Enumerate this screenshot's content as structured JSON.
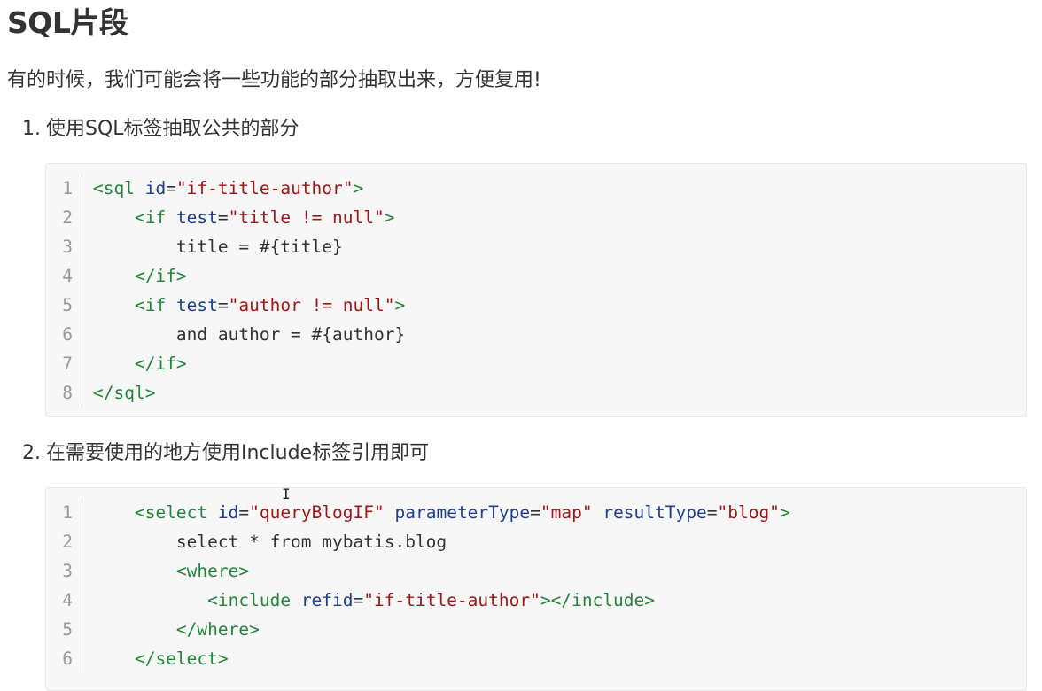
{
  "heading": "SQL片段",
  "intro": "有的时候，我们可能会将一些功能的部分抽取出来，方便复用!",
  "steps": [
    {
      "num": "1.",
      "text": "使用SQL标签抽取公共的部分"
    },
    {
      "num": "2.",
      "text": "在需要使用的地方使用Include标签引用即可"
    }
  ],
  "code_blocks": [
    {
      "line_numbers": [
        "1",
        "2",
        "3",
        "4",
        "5",
        "6",
        "7",
        "8"
      ],
      "lines": [
        [
          {
            "t": "tag",
            "v": "<sql "
          },
          {
            "t": "attr",
            "v": "id"
          },
          {
            "t": "punct",
            "v": "="
          },
          {
            "t": "str",
            "v": "\"if-title-author\""
          },
          {
            "t": "tag",
            "v": ">"
          }
        ],
        [
          {
            "t": "punct",
            "v": "    "
          },
          {
            "t": "tag",
            "v": "<if "
          },
          {
            "t": "attr",
            "v": "test"
          },
          {
            "t": "punct",
            "v": "="
          },
          {
            "t": "str",
            "v": "\"title != null\""
          },
          {
            "t": "tag",
            "v": ">"
          }
        ],
        [
          {
            "t": "punct",
            "v": "        title = #{title}"
          }
        ],
        [
          {
            "t": "punct",
            "v": "    "
          },
          {
            "t": "tag",
            "v": "</if>"
          }
        ],
        [
          {
            "t": "punct",
            "v": "    "
          },
          {
            "t": "tag",
            "v": "<if "
          },
          {
            "t": "attr",
            "v": "test"
          },
          {
            "t": "punct",
            "v": "="
          },
          {
            "t": "str",
            "v": "\"author != null\""
          },
          {
            "t": "tag",
            "v": ">"
          }
        ],
        [
          {
            "t": "punct",
            "v": "        and author = #{author}"
          }
        ],
        [
          {
            "t": "punct",
            "v": "    "
          },
          {
            "t": "tag",
            "v": "</if>"
          }
        ],
        [
          {
            "t": "tag",
            "v": "</sql>"
          }
        ]
      ]
    },
    {
      "line_numbers": [
        "1",
        "2",
        "3",
        "4",
        "5",
        "6"
      ],
      "lines": [
        [
          {
            "t": "punct",
            "v": "    "
          },
          {
            "t": "tag",
            "v": "<select "
          },
          {
            "t": "attr",
            "v": "id"
          },
          {
            "t": "punct",
            "v": "="
          },
          {
            "t": "str",
            "v": "\"queryBlogIF\""
          },
          {
            "t": "punct",
            "v": " "
          },
          {
            "t": "attr",
            "v": "parameterType"
          },
          {
            "t": "punct",
            "v": "="
          },
          {
            "t": "str",
            "v": "\"map\""
          },
          {
            "t": "punct",
            "v": " "
          },
          {
            "t": "attr",
            "v": "resultType"
          },
          {
            "t": "punct",
            "v": "="
          },
          {
            "t": "str",
            "v": "\"blog\""
          },
          {
            "t": "tag",
            "v": ">"
          }
        ],
        [
          {
            "t": "punct",
            "v": "        select * from mybatis.blog"
          }
        ],
        [
          {
            "t": "punct",
            "v": "        "
          },
          {
            "t": "tag",
            "v": "<where>"
          }
        ],
        [
          {
            "t": "punct",
            "v": "           "
          },
          {
            "t": "tag",
            "v": "<include "
          },
          {
            "t": "attr",
            "v": "refid"
          },
          {
            "t": "punct",
            "v": "="
          },
          {
            "t": "str",
            "v": "\"if-title-author\""
          },
          {
            "t": "tag",
            "v": "></include>"
          }
        ],
        [
          {
            "t": "punct",
            "v": "        "
          },
          {
            "t": "tag",
            "v": "</where>"
          }
        ],
        [
          {
            "t": "punct",
            "v": "    "
          },
          {
            "t": "tag",
            "v": "</select>"
          }
        ]
      ]
    }
  ],
  "colors": {
    "tag": "#22863a",
    "attr": "#1c3f95",
    "string": "#a31515",
    "text": "#333333",
    "code_bg": "#f7f7f7"
  },
  "cursor_icon": "text-cursor-icon"
}
